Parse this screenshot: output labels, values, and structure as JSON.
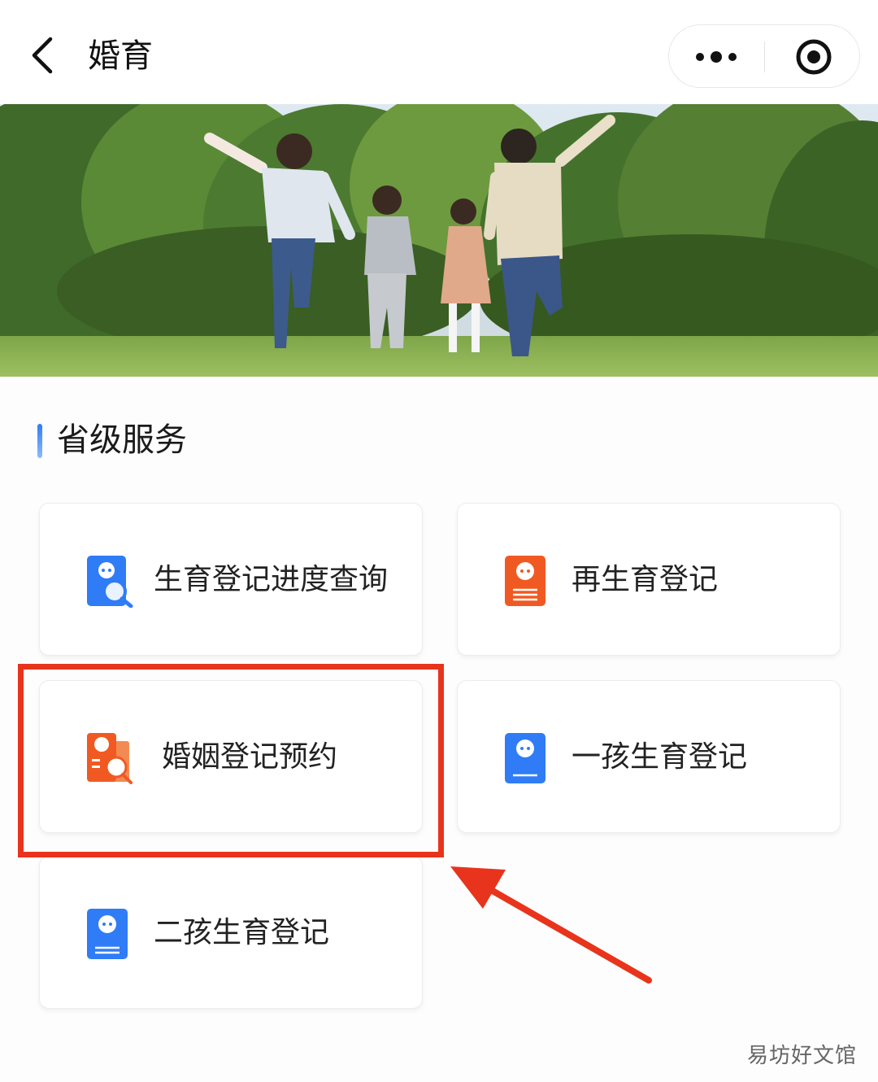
{
  "navbar": {
    "title": "婚育",
    "back_icon": "chevron-left-icon",
    "more_icon": "more-dots-icon",
    "target_icon": "target-circle-icon"
  },
  "banner": {
    "description": "family-running-on-grass"
  },
  "section": {
    "title": "省级服务",
    "accent_color": "#2f7cf6"
  },
  "services": [
    {
      "label": "生育登记进度查询",
      "icon": "birth-query-icon",
      "color": "#2f7cf6"
    },
    {
      "label": "再生育登记",
      "icon": "remarriage-birth-icon",
      "color": "#f05a22"
    },
    {
      "label": "婚姻登记预约",
      "icon": "marriage-appointment-icon",
      "color": "#f05a22"
    },
    {
      "label": "一孩生育登记",
      "icon": "first-child-icon",
      "color": "#2f7cf6"
    },
    {
      "label": "二孩生育登记",
      "icon": "second-child-icon",
      "color": "#2f7cf6"
    }
  ],
  "annotation": {
    "color": "#e8341c",
    "highlighted_item": "婚姻登记预约"
  },
  "watermark": "易坊好文馆"
}
